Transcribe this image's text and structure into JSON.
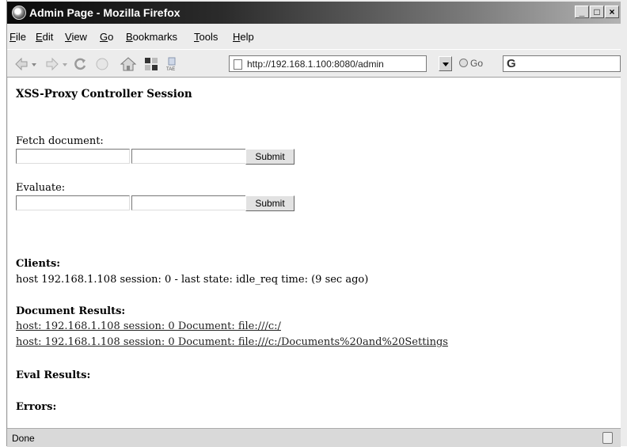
{
  "window": {
    "title": "Admin Page - Mozilla Firefox",
    "buttons": {
      "minimize": "_",
      "maximize": "□",
      "close": "×"
    }
  },
  "menubar": {
    "items": [
      "File",
      "Edit",
      "View",
      "Go",
      "Bookmarks",
      "Tools",
      "Help"
    ]
  },
  "toolbar": {
    "icons": [
      "back-icon",
      "forward-icon",
      "reload-icon",
      "stop-icon",
      "home-icon",
      "screen-icon",
      "tab-icon"
    ],
    "tab_icon_label": "TAE",
    "url": "http://192.168.1.100:8080/admin",
    "go_label": "Go",
    "search_placeholder": ""
  },
  "page": {
    "heading": "XSS-Proxy Controller Session",
    "fetch": {
      "label": "Fetch document:",
      "field1": "",
      "field2": "",
      "submit": "Submit"
    },
    "evaluate": {
      "label": "Evaluate:",
      "field1": "",
      "field2": "",
      "submit": "Submit"
    },
    "clients": {
      "heading": "Clients:",
      "entries": [
        "host 192.168.1.108 session: 0 - last state: idle_req time: (9 sec ago)"
      ]
    },
    "document_results": {
      "heading": "Document Results:",
      "links": [
        "host: 192.168.1.108 session: 0 Document: file:///c:/",
        "host: 192.168.1.108 session: 0 Document: file:///c:/Documents%20and%20Settings"
      ]
    },
    "eval_results": {
      "heading": "Eval Results:"
    },
    "errors": {
      "heading": "Errors:"
    }
  },
  "statusbar": {
    "text": "Done"
  }
}
